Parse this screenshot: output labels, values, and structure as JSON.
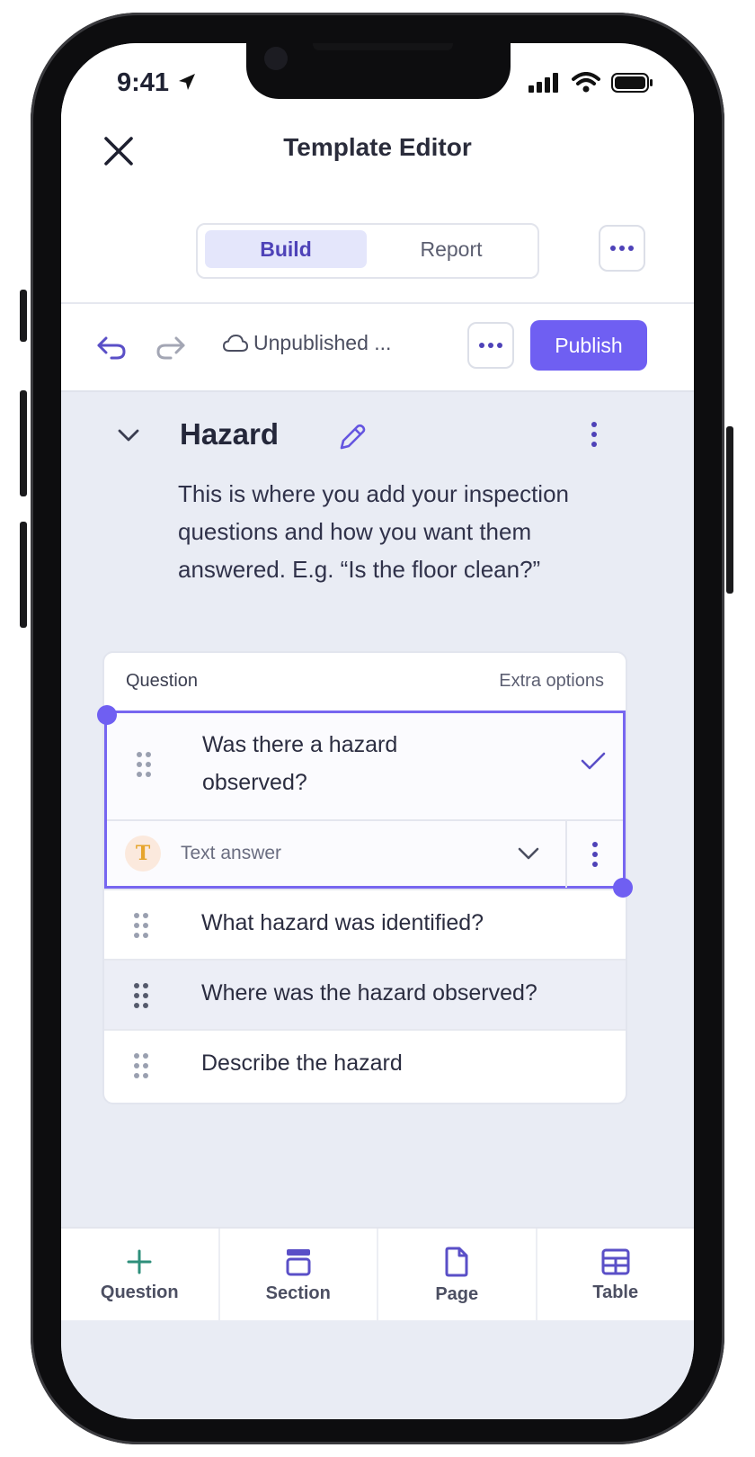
{
  "status_bar": {
    "time": "9:41"
  },
  "header": {
    "title": "Template Editor"
  },
  "mode_tabs": [
    {
      "label": "Build",
      "active": true
    },
    {
      "label": "Report",
      "active": false
    }
  ],
  "toolbar": {
    "status_label": "Unpublished ...",
    "publish_label": "Publish"
  },
  "section": {
    "title": "Hazard",
    "description": "This is where you add your inspection questions and how you want them answered. E.g. “Is the floor clean?”"
  },
  "question_table": {
    "header_left": "Question",
    "header_right": "Extra options",
    "selected": {
      "question": "Was there a hazard observed?",
      "answer_type": "Text answer",
      "answer_badge": "T"
    },
    "rows": [
      {
        "question": "What hazard was identified?"
      },
      {
        "question": "Where was the hazard observed?"
      },
      {
        "question": "Describe the hazard"
      }
    ]
  },
  "bottom_bar": [
    {
      "label": "Question",
      "icon": "plus-icon"
    },
    {
      "label": "Section",
      "icon": "section-icon"
    },
    {
      "label": "Page",
      "icon": "page-icon"
    },
    {
      "label": "Table",
      "icon": "table-icon"
    }
  ],
  "colors": {
    "accent": "#6f5ff2",
    "accent_text": "#4e42b8",
    "plus_green": "#2e8f7b"
  }
}
